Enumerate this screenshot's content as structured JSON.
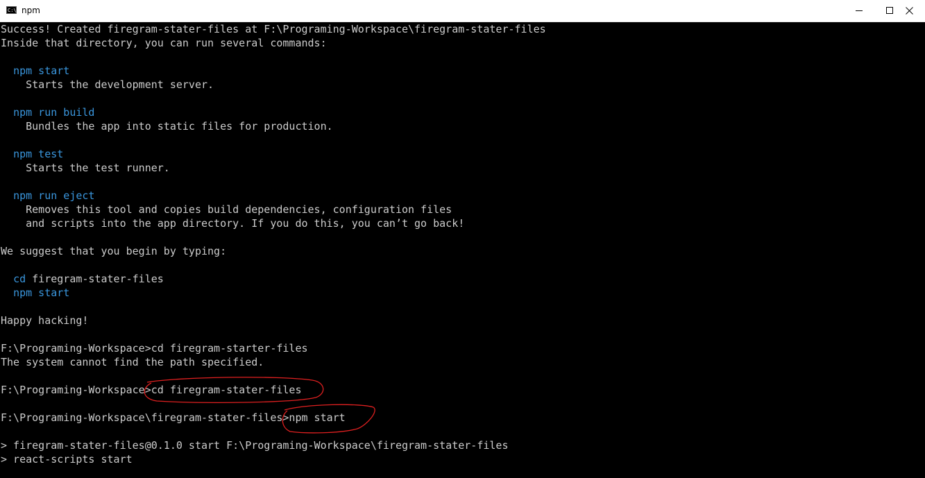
{
  "window": {
    "title": "npm"
  },
  "terminal": {
    "lines": [
      [
        "Success! Created firegram-stater-files at F:\\Programing-Workspace\\firegram-stater-files"
      ],
      [
        "Inside that directory, you can run several commands:"
      ],
      [
        ""
      ],
      [
        "  ",
        "npm start"
      ],
      [
        "    Starts the development server."
      ],
      [
        ""
      ],
      [
        "  ",
        "npm run build"
      ],
      [
        "    Bundles the app into static files for production."
      ],
      [
        ""
      ],
      [
        "  ",
        "npm test"
      ],
      [
        "    Starts the test runner."
      ],
      [
        ""
      ],
      [
        "  ",
        "npm run eject"
      ],
      [
        "    Removes this tool and copies build dependencies, configuration files"
      ],
      [
        "    and scripts into the app directory. If you do this, you can’t go back!"
      ],
      [
        ""
      ],
      [
        "We suggest that you begin by typing:"
      ],
      [
        ""
      ],
      [
        "  ",
        "cd",
        " firegram-stater-files"
      ],
      [
        "  ",
        "npm start"
      ],
      [
        ""
      ],
      [
        "Happy hacking!"
      ],
      [
        ""
      ],
      [
        "F:\\Programing-Workspace>cd firegram-starter-files"
      ],
      [
        "The system cannot find the path specified."
      ],
      [
        ""
      ],
      [
        "F:\\Programing-Workspace>cd firegram-stater-files"
      ],
      [
        ""
      ],
      [
        "F:\\Programing-Workspace\\firegram-stater-files>npm start"
      ],
      [
        ""
      ],
      [
        "> firegram-stater-files@0.1.0 start F:\\Programing-Workspace\\firegram-stater-files"
      ],
      [
        "> react-scripts start"
      ]
    ]
  },
  "colors": {
    "background": "#000000",
    "text": "#cccccc",
    "command_highlight": "#3a96dd",
    "annotation_ink": "#e02020"
  },
  "icons": {
    "app": "console-icon",
    "minimize": "minimize-icon",
    "maximize": "maximize-icon",
    "close": "close-icon"
  }
}
